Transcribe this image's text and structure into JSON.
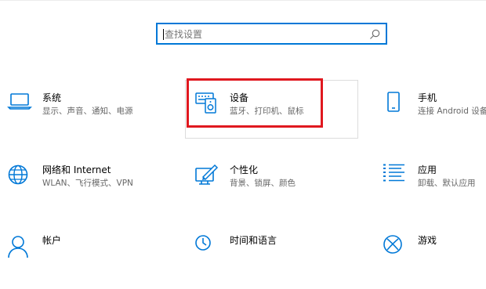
{
  "search": {
    "placeholder": "查找设置",
    "icon": "search-icon"
  },
  "accent_color": "#0078d7",
  "highlight_color": "#e0181f",
  "tiles": [
    {
      "name": "系统",
      "desc": "显示、声音、通知、电源",
      "icon": "laptop-icon"
    },
    {
      "name": "设备",
      "desc": "蓝牙、打印机、鼠标",
      "icon": "devices-icon"
    },
    {
      "name": "手机",
      "desc": "连接 Android 设备",
      "icon": "phone-icon"
    },
    {
      "name": "网络和 Internet",
      "desc": "WLAN、飞行模式、VPN",
      "icon": "globe-icon"
    },
    {
      "name": "个性化",
      "desc": "背景、锁屏、颜色",
      "icon": "personalization-icon"
    },
    {
      "name": "应用",
      "desc": "卸载、默认应用",
      "icon": "apps-list-icon"
    },
    {
      "name": "帐户",
      "desc": "",
      "icon": "account-icon"
    },
    {
      "name": "时间和语言",
      "desc": "",
      "icon": "time-language-icon"
    },
    {
      "name": "游戏",
      "desc": "",
      "icon": "xbox-icon"
    }
  ]
}
